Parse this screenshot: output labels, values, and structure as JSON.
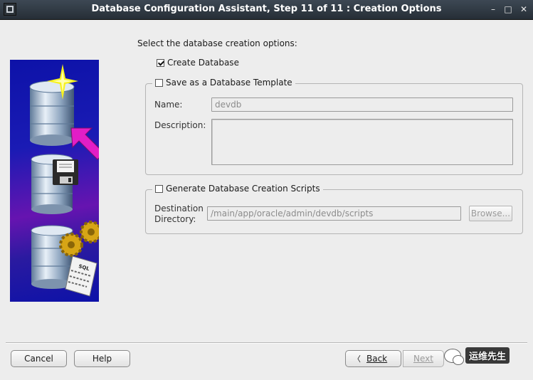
{
  "window": {
    "title": "Database Configuration Assistant, Step 11 of 11 : Creation Options",
    "min_glyph": "–",
    "max_glyph": "□",
    "close_glyph": "✕"
  },
  "main": {
    "prompt": "Select the database creation options:",
    "create_database": {
      "label": "Create Database",
      "checked": true
    },
    "template_group": {
      "label": "Save as a Database Template",
      "checked": false,
      "name_label": "Name:",
      "name_value": "devdb",
      "description_label": "Description:",
      "description_value": ""
    },
    "scripts_group": {
      "label": "Generate Database Creation Scripts",
      "checked": false,
      "dest_label_line1": "Destination",
      "dest_label_line2": "Directory:",
      "dest_value": "/main/app/oracle/admin/devdb/scripts",
      "browse_label": "Browse..."
    }
  },
  "illustration": {
    "sql_label": "SQL"
  },
  "footer": {
    "cancel_label": "Cancel",
    "help_label": "Help",
    "back_label": "Back",
    "next_label": "Next",
    "back_arrow": "〈",
    "watermark_text": "运维先生"
  },
  "colors": {
    "titlebar": "#2e363f",
    "illustration_bg": "#1a1bb4",
    "arrow_magenta": "#e21ec6"
  }
}
